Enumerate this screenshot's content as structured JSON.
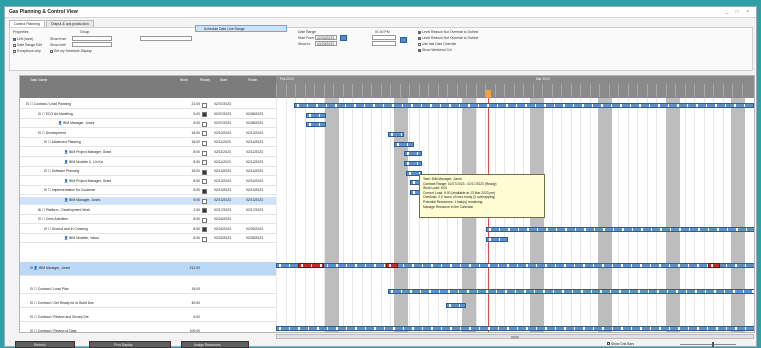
{
  "window": {
    "title": "Gas Planning & Control View",
    "controls": "_ □ ×"
  },
  "tabs": [
    {
      "label": "Control Planning"
    },
    {
      "label": "Output & ops production"
    }
  ],
  "options": {
    "properties_label": "Properties",
    "group_label": "Group",
    "left_checks": [
      "Left (none)",
      "Date Range Edit",
      "Exceptions only"
    ],
    "show_from": "Show from",
    "show_to": "Show until",
    "checkbox_range": "Set my Schedule Display",
    "list_selected": "Schedule Date Line Range",
    "date_labels": [
      "Date Range",
      "Start From",
      "Show to"
    ],
    "start_value": "02/03/2023",
    "end_value": "03/29/2023",
    "start_time": "01:00 PM",
    "right_checks": [
      "Level Reason Not Override to Outline",
      "Level Reason Not Override to Outline",
      "Use last Date Override",
      "Show Weekend Col"
    ]
  },
  "grid": {
    "headers": [
      "Task Name",
      "Work",
      "Ready",
      "Start",
      "Finish"
    ],
    "months": [
      "Feb 2023",
      "Mar 2023"
    ],
    "rows": [
      {
        "name": "⊟ ☐ Contract / Lead Planning",
        "work": "21:00",
        "checked": false,
        "start": "02/07/2023",
        "finish": "",
        "indent": 6
      },
      {
        "name": "⊟ ☐ ECO Air Modeling",
        "work": "5:00",
        "checked": true,
        "start": "02/07/2023",
        "finish": "02/08/2023",
        "indent": 18
      },
      {
        "name": "👤 BIM Manager, Jones",
        "work": "5:00",
        "checked": false,
        "start": "02/07/2023",
        "finish": "02/08/2023",
        "indent": 38
      },
      {
        "name": "⊟ ☐ Development",
        "work": "16:00",
        "checked": false,
        "start": "02/10/2023",
        "finish": "02/13/2023",
        "indent": 18
      },
      {
        "name": "⊟ ☐ Advanced Planning",
        "work": "16:00",
        "checked": false,
        "start": "02/11/2023",
        "finish": "02/14/2023",
        "indent": 24
      },
      {
        "name": "👤 BIM Project Manager, Grant",
        "work": "8:00",
        "checked": false,
        "start": "02/11/2023",
        "finish": "02/12/2023",
        "indent": 44
      },
      {
        "name": "👤 BIM Modeler II, Lin Ka",
        "work": "8:00",
        "checked": false,
        "start": "02/11/2023",
        "finish": "02/12/2023",
        "indent": 44
      },
      {
        "name": "⊟ ☐ Software Planning",
        "work": "16:00",
        "checked": true,
        "start": "02/13/2023",
        "finish": "02/14/2023",
        "indent": 24
      },
      {
        "name": "👤 BIM Project Manager, Grant",
        "work": "8:00",
        "checked": false,
        "start": "02/13/2023",
        "finish": "02/14/2023",
        "indent": 44
      },
      {
        "name": "⊟ ☐ Implementation for Customer",
        "work": "5:00",
        "checked": true,
        "start": "02/13/2023",
        "finish": "02/13/2023",
        "indent": 24
      },
      {
        "name": "👤 BIM Manager, Jones",
        "work": "5:00",
        "checked": false,
        "start": "02/13/2023",
        "finish": "02/13/2023",
        "indent": 44
      },
      {
        "name": "⊞ ☐ Platform - Development Work",
        "work": "2:00",
        "checked": true,
        "start": "02/17/2023",
        "finish": "02/17/2023",
        "indent": 18
      },
      {
        "name": "⊟ ☐ Crew Activities",
        "work": "8:00",
        "checked": false,
        "start": "02/24/2023",
        "finish": "",
        "indent": 18
      },
      {
        "name": "⊟ ☐ Ground and In Crossing",
        "work": "8:00",
        "checked": true,
        "start": "02/24/2023",
        "finish": "02/25/2023",
        "indent": 24
      },
      {
        "name": "👤 BIM Modeler, Vasco",
        "work": "8:00",
        "checked": false,
        "start": "02/24/2023",
        "finish": "02/25/2023",
        "indent": 44
      }
    ],
    "selected_resource": {
      "name": "BIM Manager, Jones",
      "work": "212:00"
    },
    "lower_rows": [
      {
        "name": "⊟ ☐ Contract / Lead Plan",
        "work": "15:00"
      },
      {
        "name": "⊟ ☐ Contract / Get Ready for to Build Due",
        "work": "40:00"
      },
      {
        "name": "⊟ ☐ Contract / Review and Survey Die",
        "work": "5:00"
      },
      {
        "name": "⊟ ☐ Contract / Review of Data",
        "work": "100:00"
      }
    ]
  },
  "tooltip": {
    "lines": [
      "Task: BIM Manager, Jones",
      "Contract Range: 02/17/2023 - 02/17/2023 (Ready)",
      "Work Load: 5:00",
      "Current Load: 5:00 (available at 13 Mar 2023 pm)",
      "Overload: 2.0 hours of over-ready (3 overlapping)",
      "Potential Resources: 1 task(s) remaining",
      "Manage Resource in the Calendar"
    ]
  },
  "footer": {
    "buttons": [
      "Refresh",
      "Print Display",
      "Assign Resources"
    ],
    "show_bar_label": "Show Grid Bars"
  },
  "colors": {
    "background": "#2fa0a7",
    "bar": "#5d8fc8",
    "overload": "#c42d2d",
    "today_marker": "#f2a23a",
    "selection": "#cfe3fa"
  }
}
